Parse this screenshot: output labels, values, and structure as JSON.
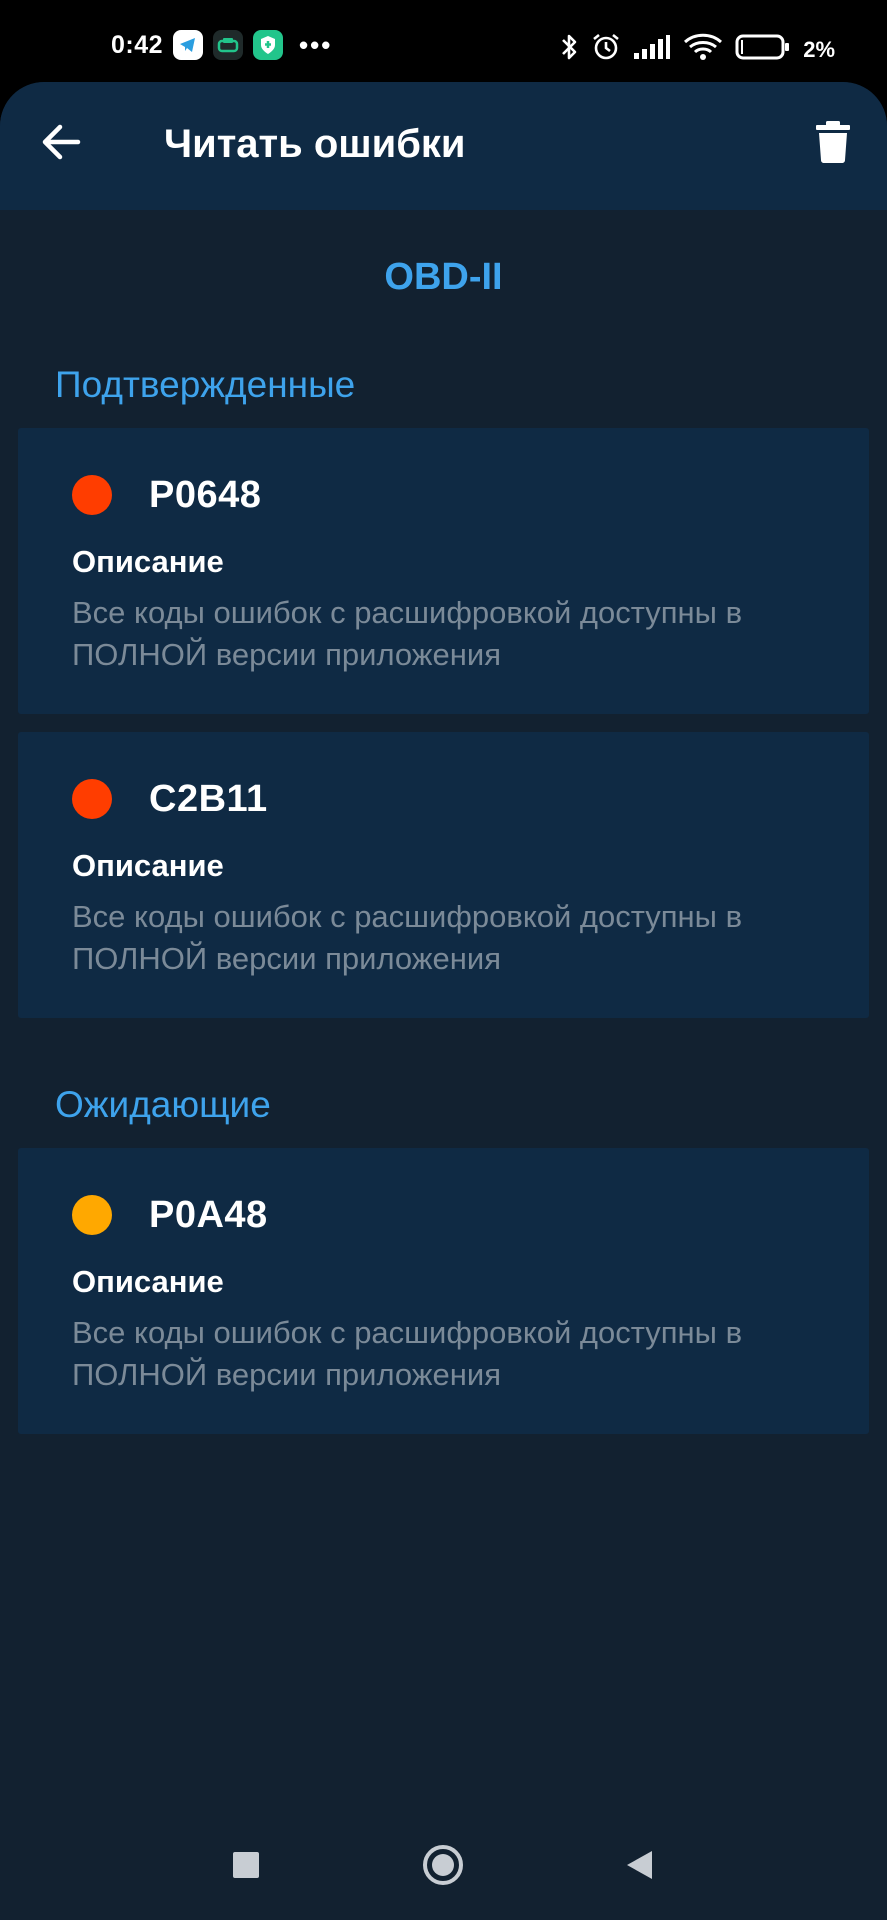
{
  "status_bar": {
    "time": "0:42",
    "battery": "2%",
    "icons": [
      "telegram-icon",
      "car-app-icon",
      "shield-app-icon",
      "more-dots-icon",
      "bluetooth-icon",
      "alarm-icon",
      "signal-icon",
      "wifi-icon",
      "battery-icon"
    ],
    "dots": "•••"
  },
  "app_bar": {
    "title": "Читать ошибки",
    "back_icon": "arrow-left-icon",
    "delete_icon": "trash-icon"
  },
  "protocol": "OBD-II",
  "sections": [
    {
      "title": "Подтвержденные",
      "errors": [
        {
          "code": "P0648",
          "status_color": "#ff3d00",
          "description_label": "Описание",
          "description": "Все коды ошибок с расшифровкой доступны в ПОЛНОЙ версии приложения"
        },
        {
          "code": "C2B11",
          "status_color": "#ff3d00",
          "description_label": "Описание",
          "description": "Все коды ошибок с расшифровкой доступны в ПОЛНОЙ версии приложения"
        }
      ]
    },
    {
      "title": "Ожидающие",
      "errors": [
        {
          "code": "P0A48",
          "status_color": "#ffa800",
          "description_label": "Описание",
          "description": "Все коды ошибок с расшифровкой доступны в ПОЛНОЙ версии приложения"
        }
      ]
    }
  ],
  "nav_bar": {
    "icons": [
      "recents-square-icon",
      "home-circle-icon",
      "back-triangle-icon"
    ]
  },
  "colors": {
    "accent": "#3ea3ec",
    "background": "#122130",
    "card": "#0f2a44",
    "confirmed_dot": "#ff3d00",
    "pending_dot": "#ffa800",
    "muted_text": "#7b8a98"
  }
}
